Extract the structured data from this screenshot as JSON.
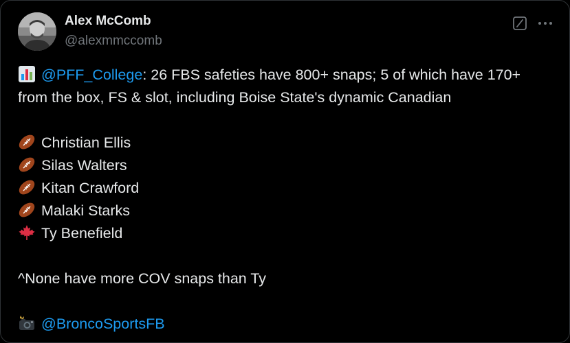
{
  "author": {
    "name": "Alex McComb",
    "handle": "@alexmmccomb"
  },
  "post": {
    "intro_icon": "bar-chart-emoji",
    "mention_1": "@PFF_College",
    "intro_rest": ": 26 FBS safeties have 800+ snaps; 5 of which have 170+ from the box, FS & slot, including Boise State's dynamic Canadian",
    "players": [
      {
        "icon": "american-football-emoji",
        "name": "Christian Ellis"
      },
      {
        "icon": "american-football-emoji",
        "name": "Silas Walters"
      },
      {
        "icon": "american-football-emoji",
        "name": "Kitan Crawford"
      },
      {
        "icon": "american-football-emoji",
        "name": "Malaki Starks"
      },
      {
        "icon": "maple-leaf-emoji",
        "name": "Ty Benefield"
      }
    ],
    "note": "^None have more COV snaps than Ty",
    "credit_icon": "camera-flash-emoji",
    "mention_2": "@BroncoSportsFB"
  },
  "colors": {
    "background": "#000000",
    "text": "#e7e9ea",
    "muted": "#71767b",
    "link": "#1d9bf0",
    "border": "#2f3336"
  },
  "icons": {
    "grok": "grok-icon",
    "more": "more-options-icon"
  }
}
